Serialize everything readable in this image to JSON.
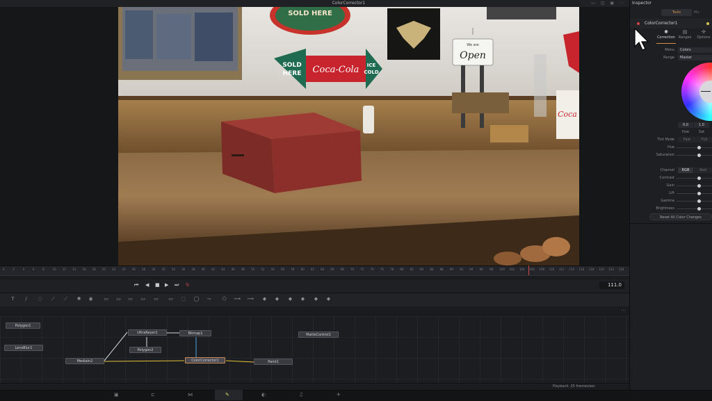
{
  "viewer": {
    "title": "ColorCorrector1"
  },
  "signs": {
    "top_sign": "SOLD HERE",
    "arrow_left_line1": "SOLD",
    "arrow_left_line2": "HERE",
    "arrow_brand": "Coca-Cola",
    "arrow_right_line1": "ICE",
    "arrow_right_line2": "COLD",
    "open_small": "We are",
    "open_big": "Open",
    "right_brand": "Coca"
  },
  "timeline": {
    "ruler_ticks": [
      "0",
      "2",
      "4",
      "6",
      "8",
      "10",
      "12",
      "14",
      "16",
      "18",
      "20",
      "22",
      "24",
      "26",
      "28",
      "30",
      "32",
      "34",
      "36",
      "38",
      "40",
      "42",
      "44",
      "46",
      "48",
      "50",
      "52",
      "54",
      "56",
      "58",
      "60",
      "62",
      "64",
      "66",
      "68",
      "70",
      "72",
      "74",
      "76",
      "78",
      "80",
      "82",
      "84",
      "86",
      "88",
      "90",
      "92",
      "94",
      "96",
      "98",
      "100",
      "102",
      "104",
      "106",
      "108",
      "110",
      "112",
      "114",
      "116",
      "118",
      "120",
      "122",
      "124"
    ],
    "current_frame": "111.0",
    "playhead_fraction": 0.8395
  },
  "transport": {
    "go_start": "⏮",
    "step_back": "◀",
    "stop": "■",
    "play": "▶",
    "go_end": "⏭",
    "loop": "↻"
  },
  "toolbar_icons": [
    "T",
    "/",
    "◌",
    "⟋",
    "⟋",
    "✺",
    "◉",
    "▭",
    "▭",
    "▭",
    "▭",
    "▭",
    "▭",
    "⬚",
    "◯",
    "⤳",
    "⬠",
    "⟿",
    "⟿",
    "◆",
    "◆",
    "◆",
    "◆",
    "◆",
    "◆"
  ],
  "nodes": {
    "polygon1": "Polygon1",
    "lensblur1": "LensBlur1",
    "ultrakeyer1": "UltraKeyer1",
    "bitmap1": "Bitmap1",
    "polygon2": "Polygon2",
    "mediain2": "MediaIn2",
    "colorcorrector1": "ColorCorrector1",
    "paint1": "Paint1",
    "mattecontrol1": "MatteControl1"
  },
  "node_header": {
    "more": "···"
  },
  "status": {
    "playback": "Playback: 25 frames/sec"
  },
  "pages": [
    "▣",
    "⊏",
    "⋈",
    "✎",
    "◐",
    "♫",
    "✈"
  ],
  "inspector": {
    "title": "Inspector",
    "tab_tools": "Tools",
    "tab_modifiers": "Mo",
    "tool_name": "ColorCorrector1",
    "subtabs": [
      {
        "label": "Correction",
        "icon": "✺"
      },
      {
        "label": "Ranges",
        "icon": "▤"
      },
      {
        "label": "Options",
        "icon": "✣"
      }
    ],
    "menu_label": "Menu",
    "menu_value": "Colors",
    "range_label": "Range",
    "range_value": "Master",
    "hue_value": "0.0",
    "sat_value": "1.0",
    "hue_label": "Hue",
    "sat_label": "Sat",
    "tint_mode_label": "Tint Mode",
    "tint_fast": "Fast",
    "tint_full": "Full",
    "hue_row": "Hue",
    "saturation_row": "Saturation",
    "channel_label": "Channel",
    "channel_rgb": "RGB",
    "channel_red": "Red",
    "contrast": "Contrast",
    "gain": "Gain",
    "lift": "Lift",
    "gamma": "Gamma",
    "brightness": "Brightness",
    "reset_all": "Reset All Color Changes"
  },
  "colors": {
    "accent": "#d68c4f",
    "selected_node": "#c98a5b",
    "playhead": "#d04848",
    "active_page": "#e2d36b"
  },
  "icons": {
    "cursor": "pointer-cursor-icon"
  }
}
